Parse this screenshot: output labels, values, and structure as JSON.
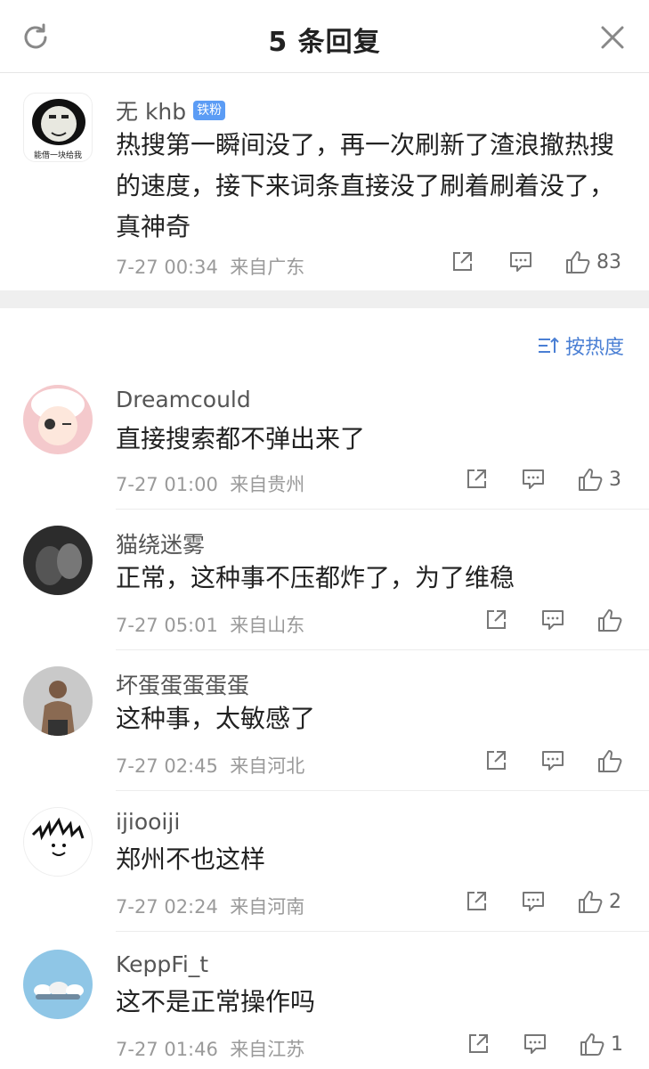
{
  "header": {
    "title": "5 条回复",
    "refresh_icon": "refresh-icon",
    "close_icon": "close-icon"
  },
  "root_comment": {
    "username": "无 khb",
    "badge": "铁粉",
    "avatar_caption": "能借一块给我",
    "text": "热搜第一瞬间没了，再一次刷新了渣浪撤热搜的速度，接下来词条直接没了刷着刷着没了，真神奇",
    "time": "7-27 00:34",
    "location": "来自广东",
    "likes": "83"
  },
  "sort": {
    "label": "按热度",
    "icon": "sort-icon"
  },
  "replies": [
    {
      "username": "Dreamcould",
      "text": "直接搜索都不弹出来了",
      "time": "7-27 01:00",
      "location": "来自贵州",
      "likes": "3",
      "avatar_color": "#f4c9cc"
    },
    {
      "username": "猫绕迷雾",
      "text": "正常，这种事不压都炸了，为了维稳",
      "time": "7-27 05:01",
      "location": "来自山东",
      "likes": "",
      "avatar_color": "#2c2c2c"
    },
    {
      "username": "坏蛋蛋蛋蛋蛋",
      "text": "这种事，太敏感了",
      "time": "7-27 02:45",
      "location": "来自河北",
      "likes": "",
      "avatar_color": "#9a9a9a"
    },
    {
      "username": "ijiooiji",
      "text": "郑州不也这样",
      "time": "7-27 02:24",
      "location": "来自河南",
      "likes": "2",
      "avatar_color": "#ffffff"
    },
    {
      "username": "KeppFi_t",
      "text": "这不是正常操作吗",
      "time": "7-27 01:46",
      "location": "来自江苏",
      "likes": "1",
      "avatar_color": "#8fc6e6"
    }
  ]
}
